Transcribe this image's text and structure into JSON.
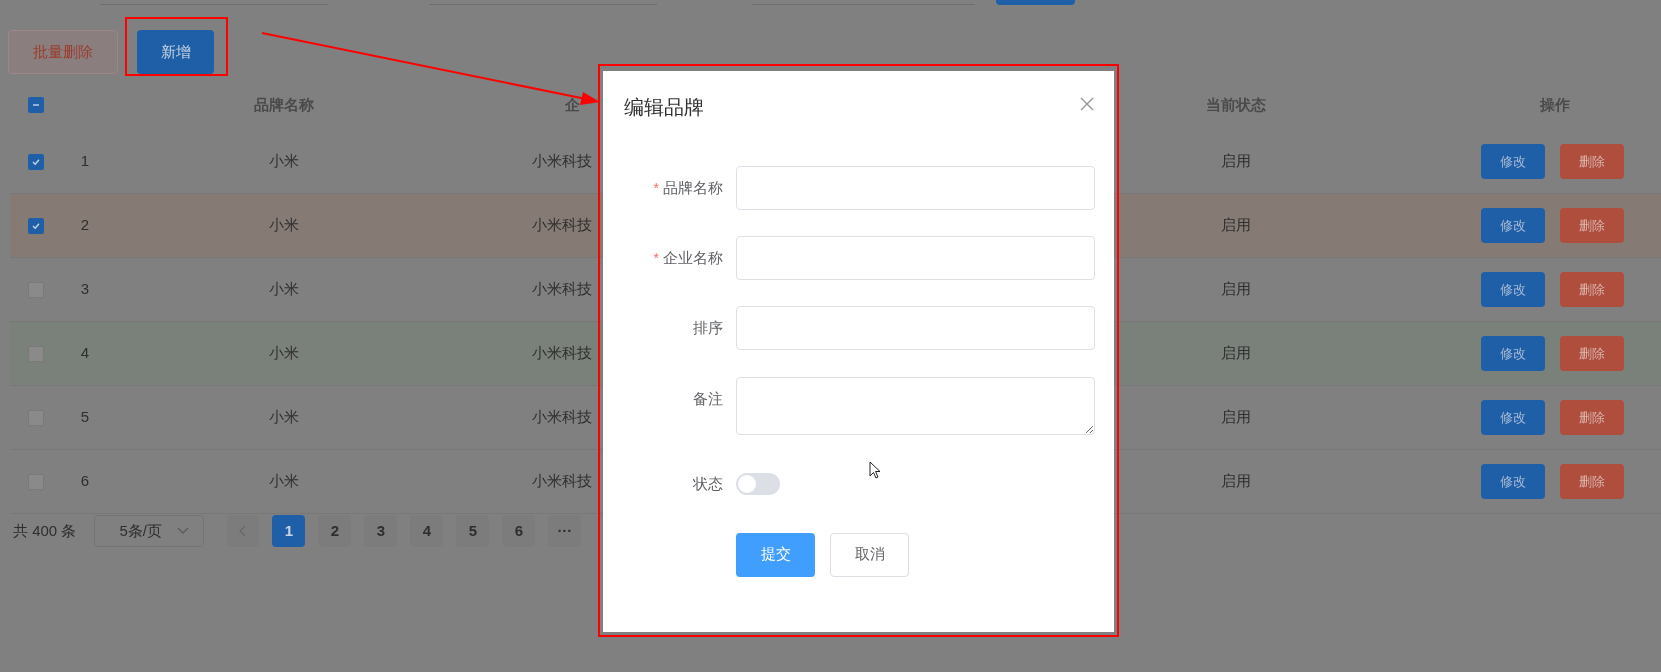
{
  "toolbar": {
    "buttons": [
      {
        "label": "批量删除",
        "kind": "danger"
      },
      {
        "label": "新增",
        "kind": "primary"
      }
    ]
  },
  "table": {
    "header_checkbox": {
      "indeterminate": true
    },
    "columns": [
      {
        "label": "品牌名称"
      },
      {
        "label": "企"
      },
      {
        "label": "当前状态"
      },
      {
        "label": "操作"
      }
    ],
    "rows": [
      {
        "checked": true,
        "index": "1",
        "brand": "小米",
        "company": "小米科技",
        "status": "启用",
        "actions": [
          "修改",
          "删除"
        ],
        "color": "#808080"
      },
      {
        "checked": true,
        "index": "2",
        "brand": "小米",
        "company": "小米科技",
        "status": "启用",
        "actions": [
          "修改",
          "删除"
        ],
        "color": "#857b74"
      },
      {
        "checked": false,
        "index": "3",
        "brand": "小米",
        "company": "小米科技",
        "status": "启用",
        "actions": [
          "修改",
          "删除"
        ],
        "color": "#808080"
      },
      {
        "checked": false,
        "index": "4",
        "brand": "小米",
        "company": "小米科技",
        "status": "启用",
        "actions": [
          "修改",
          "删除"
        ],
        "color": "#7a807a"
      },
      {
        "checked": false,
        "index": "5",
        "brand": "小米",
        "company": "小米科技",
        "status": "启用",
        "actions": [
          "修改",
          "删除"
        ],
        "color": "#808080"
      },
      {
        "checked": false,
        "index": "6",
        "brand": "小米",
        "company": "小米科技",
        "status": "启用",
        "actions": [
          "修改",
          "删除"
        ],
        "color": "#808080"
      }
    ]
  },
  "pagination": {
    "total": "共 400 条",
    "page_size": "5条/页",
    "pages": [
      {
        "label": "1",
        "selected": true
      },
      {
        "label": "2",
        "selected": false
      },
      {
        "label": "3",
        "selected": false
      },
      {
        "label": "4",
        "selected": false
      },
      {
        "label": "5",
        "selected": false
      },
      {
        "label": "6",
        "selected": false
      },
      {
        "label": "···",
        "selected": false
      }
    ]
  },
  "dialog": {
    "title": "编辑品牌",
    "fields": [
      {
        "kind": "input",
        "mark": "*",
        "label": "品牌名称"
      },
      {
        "kind": "input",
        "mark": "*",
        "label": "企业名称"
      },
      {
        "kind": "input",
        "label": "排序"
      },
      {
        "kind": "textarea",
        "label": "备注"
      },
      {
        "kind": "switch",
        "label": "状态",
        "on": false
      }
    ],
    "buttons": [
      {
        "label": "提交",
        "kind": "primary"
      },
      {
        "label": "取消",
        "kind": "default"
      }
    ]
  }
}
